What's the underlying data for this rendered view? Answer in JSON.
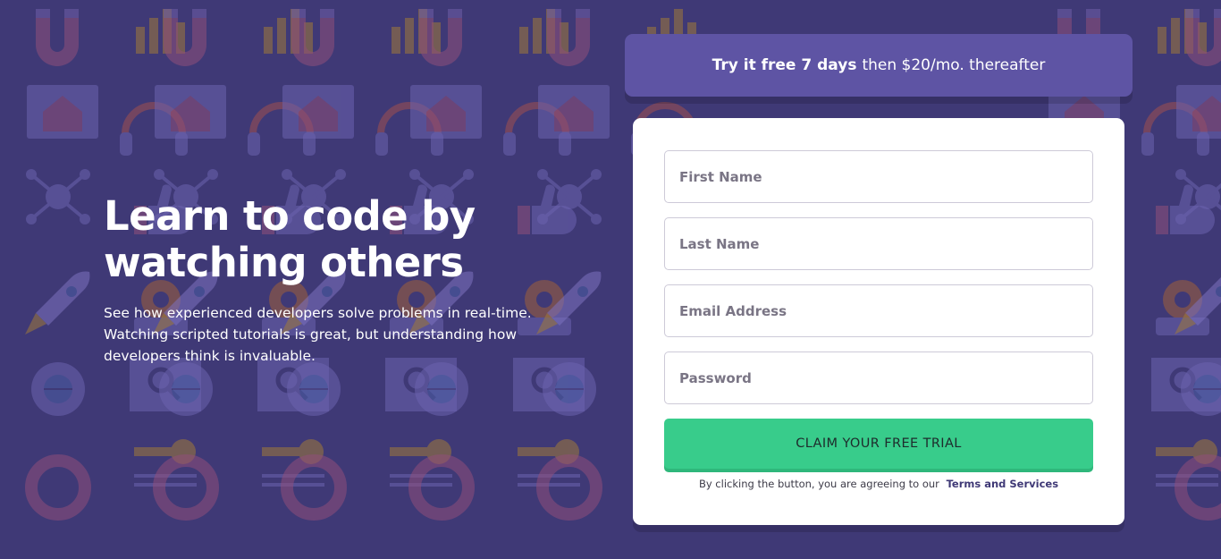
{
  "colors": {
    "background": "#3f3976",
    "promo": "#5e54a4",
    "cta": "#38cc8b",
    "link": "#3f3976"
  },
  "hero": {
    "title_line1": "Learn to code by",
    "title_line2": "watching others",
    "description": "See how experienced developers solve problems in real-time. Watching scripted tutorials is great, but understanding how developers think is invaluable."
  },
  "promo": {
    "strong": "Try it free 7 days",
    "rest": "then $20/mo. thereafter"
  },
  "form": {
    "fields": [
      {
        "placeholder": "First Name"
      },
      {
        "placeholder": "Last Name"
      },
      {
        "placeholder": "Email Address"
      },
      {
        "placeholder": "Password"
      }
    ],
    "cta_label": "CLAIM YOUR FREE TRIAL",
    "terms_text": "By clicking the button, you are agreeing to our",
    "terms_link": "Terms and Services"
  },
  "background_icons": [
    "magnet-icon",
    "bar-chart-icon",
    "house-window-icon",
    "headset-icon",
    "network-icon",
    "thumbs-up-icon",
    "rocket-icon",
    "gear-icon",
    "globe-icon",
    "magnifier-icon",
    "key-icon",
    "lifebuoy-icon"
  ]
}
